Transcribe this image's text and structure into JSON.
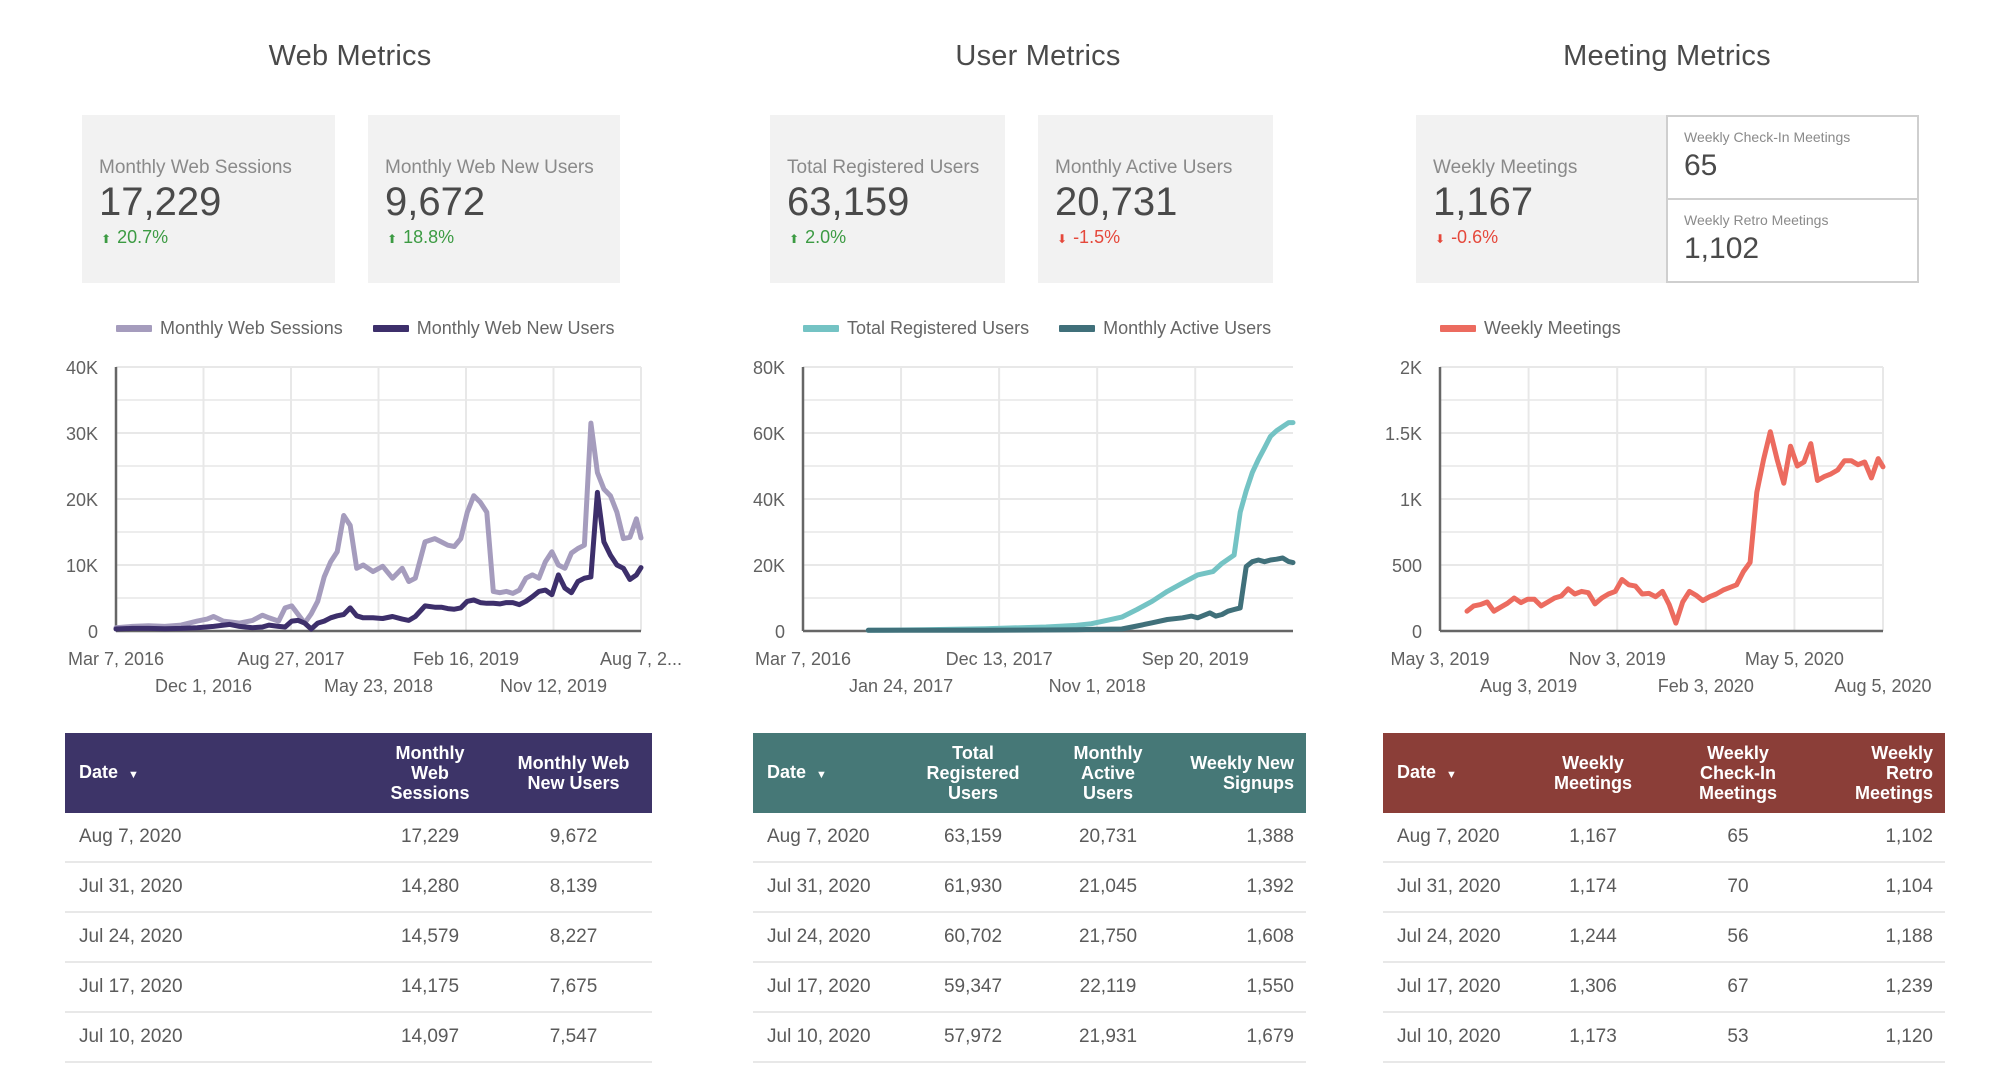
{
  "panels": {
    "web": {
      "title": "Web Metrics",
      "cards": [
        {
          "label": "Monthly Web Sessions",
          "value": "17,229",
          "delta": "20.7%",
          "direction": "up"
        },
        {
          "label": "Monthly Web New Users",
          "value": "9,672",
          "delta": "18.8%",
          "direction": "up"
        }
      ],
      "table": {
        "header_color": "#3d3468",
        "columns": [
          "Date",
          "Monthly Web Sessions",
          "Monthly Web New Users"
        ],
        "sort_icon": "sort-desc-icon",
        "rows": [
          [
            "Aug 7, 2020",
            "17,229",
            "9,672"
          ],
          [
            "Jul 31, 2020",
            "14,280",
            "8,139"
          ],
          [
            "Jul 24, 2020",
            "14,579",
            "8,227"
          ],
          [
            "Jul 17, 2020",
            "14,175",
            "7,675"
          ],
          [
            "Jul 10, 2020",
            "14,097",
            "7,547"
          ]
        ]
      }
    },
    "user": {
      "title": "User Metrics",
      "cards": [
        {
          "label": "Total Registered Users",
          "value": "63,159",
          "delta": "2.0%",
          "direction": "up"
        },
        {
          "label": "Monthly Active Users",
          "value": "20,731",
          "delta": "-1.5%",
          "direction": "down"
        }
      ],
      "table": {
        "header_color": "#467877",
        "columns": [
          "Date",
          "Total Registered Users",
          "Monthly Active Users",
          "Weekly New Signups"
        ],
        "sort_icon": "sort-desc-icon",
        "rows": [
          [
            "Aug 7, 2020",
            "63,159",
            "20,731",
            "1,388"
          ],
          [
            "Jul 31, 2020",
            "61,930",
            "21,045",
            "1,392"
          ],
          [
            "Jul 24, 2020",
            "60,702",
            "21,750",
            "1,608"
          ],
          [
            "Jul 17, 2020",
            "59,347",
            "22,119",
            "1,550"
          ],
          [
            "Jul 10, 2020",
            "57,972",
            "21,931",
            "1,679"
          ]
        ]
      }
    },
    "meeting": {
      "title": "Meeting Metrics",
      "cards": [
        {
          "label": "Weekly Meetings",
          "value": "1,167",
          "delta": "-0.6%",
          "direction": "down"
        }
      ],
      "mini_cards": [
        {
          "label": "Weekly Check-In Meetings",
          "value": "65"
        },
        {
          "label": "Weekly Retro Meetings",
          "value": "1,102"
        }
      ],
      "table": {
        "header_color": "#8b3e38",
        "columns": [
          "Date",
          "Weekly Meetings",
          "Weekly Check-In Meetings",
          "Weekly Retro Meetings"
        ],
        "sort_icon": "sort-desc-icon",
        "rows": [
          [
            "Aug 7, 2020",
            "1,167",
            "65",
            "1,102"
          ],
          [
            "Jul 31, 2020",
            "1,174",
            "70",
            "1,104"
          ],
          [
            "Jul 24, 2020",
            "1,244",
            "56",
            "1,188"
          ],
          [
            "Jul 17, 2020",
            "1,306",
            "67",
            "1,239"
          ],
          [
            "Jul 10, 2020",
            "1,173",
            "53",
            "1,120"
          ]
        ]
      }
    }
  },
  "icons": {
    "up": "arrow-up-icon",
    "down": "arrow-down-icon"
  },
  "colors": {
    "up": "#3c9b43",
    "down": "#e5483b"
  },
  "chart_data": [
    {
      "id": "web",
      "type": "line",
      "title": "",
      "xlabel": "",
      "ylabel": "",
      "ylim": [
        0,
        40000
      ],
      "yticks": [
        0,
        10000,
        20000,
        30000,
        40000
      ],
      "ytick_labels": [
        "0",
        "10K",
        "20K",
        "30K",
        "40K"
      ],
      "xlim": [
        0,
        1614
      ],
      "xticks": [
        0,
        269,
        538,
        807,
        1076,
        1345,
        1614
      ],
      "xtick_labels": [
        "Mar 7, 2016",
        "Dec 1, 2016",
        "Aug 27, 2017",
        "May 23, 2018",
        "Feb 16, 2019",
        "Nov 12, 2019",
        "Aug 7, 2..."
      ],
      "grid": true,
      "legend": "top",
      "series": [
        {
          "name": "Monthly Web Sessions",
          "color": "#a59cbd",
          "x": [
            0,
            50,
            100,
            150,
            200,
            250,
            280,
            300,
            330,
            380,
            420,
            450,
            470,
            500,
            520,
            540,
            560,
            580,
            600,
            620,
            640,
            660,
            680,
            700,
            720,
            740,
            760,
            790,
            820,
            850,
            880,
            900,
            920,
            950,
            980,
            1000,
            1020,
            1040,
            1060,
            1080,
            1100,
            1120,
            1140,
            1160,
            1180,
            1200,
            1220,
            1240,
            1260,
            1280,
            1300,
            1320,
            1340,
            1360,
            1380,
            1400,
            1420,
            1440,
            1460,
            1480,
            1500,
            1520,
            1540,
            1560,
            1580,
            1600,
            1614
          ],
          "y": [
            500,
            700,
            800,
            700,
            900,
            1500,
            1800,
            2200,
            1500,
            1200,
            1600,
            2400,
            2000,
            1500,
            3500,
            3800,
            2500,
            1200,
            2600,
            4500,
            8200,
            10500,
            12000,
            17500,
            16000,
            9500,
            10000,
            9000,
            9800,
            8000,
            9500,
            7500,
            8000,
            13500,
            14000,
            13500,
            13000,
            12800,
            14000,
            18000,
            20500,
            19500,
            18000,
            6000,
            5800,
            6000,
            5700,
            6200,
            8000,
            8500,
            8000,
            10500,
            12000,
            10000,
            9500,
            11800,
            12500,
            13000,
            31500,
            24000,
            21500,
            20500,
            18000,
            14000,
            14200,
            17000,
            14100
          ]
        },
        {
          "name": "Monthly Web New Users",
          "color": "#3d2f6b",
          "x": [
            0,
            50,
            100,
            150,
            200,
            250,
            300,
            350,
            380,
            420,
            450,
            470,
            500,
            520,
            540,
            560,
            580,
            600,
            620,
            640,
            660,
            680,
            700,
            720,
            740,
            760,
            790,
            820,
            850,
            880,
            900,
            920,
            950,
            980,
            1000,
            1020,
            1040,
            1060,
            1080,
            1100,
            1120,
            1140,
            1160,
            1180,
            1200,
            1220,
            1240,
            1260,
            1280,
            1300,
            1320,
            1340,
            1360,
            1380,
            1400,
            1420,
            1440,
            1460,
            1480,
            1500,
            1520,
            1540,
            1560,
            1580,
            1600,
            1614
          ],
          "y": [
            300,
            400,
            400,
            350,
            400,
            500,
            700,
            1000,
            700,
            500,
            600,
            900,
            700,
            600,
            1500,
            1600,
            1200,
            300,
            1200,
            1500,
            2000,
            2300,
            2500,
            3500,
            2300,
            2000,
            2000,
            1900,
            2200,
            1800,
            1600,
            2200,
            3800,
            3600,
            3600,
            3400,
            3300,
            3500,
            4500,
            4700,
            4300,
            4200,
            4200,
            4100,
            4300,
            4300,
            4000,
            4500,
            5200,
            6000,
            6200,
            5500,
            8500,
            6500,
            5800,
            7500,
            8000,
            8200,
            21000,
            13500,
            11500,
            10000,
            9500,
            7800,
            8500,
            9600
          ]
        }
      ]
    },
    {
      "id": "user",
      "type": "line",
      "title": "",
      "xlabel": "",
      "ylabel": "",
      "ylim": [
        0,
        80000
      ],
      "yticks": [
        0,
        20000,
        40000,
        60000,
        80000
      ],
      "ytick_labels": [
        "0",
        "20K",
        "40K",
        "60K",
        "80K"
      ],
      "xlim": [
        0,
        1614
      ],
      "xticks": [
        0,
        323,
        646,
        969,
        1292
      ],
      "xtick_labels": [
        "Mar 7, 2016",
        "Jan 24, 2017",
        "Dec 13, 2017",
        "Nov 1, 2018",
        "Sep 20, 2019"
      ],
      "grid": true,
      "legend": "top",
      "series": [
        {
          "name": "Total Registered Users",
          "color": "#74c3c4",
          "x": [
            215,
            400,
            600,
            800,
            900,
            950,
            1000,
            1050,
            1100,
            1150,
            1200,
            1250,
            1300,
            1350,
            1380,
            1420,
            1440,
            1460,
            1480,
            1500,
            1520,
            1540,
            1560,
            1580,
            1600,
            1614
          ],
          "y": [
            200,
            400,
            700,
            1200,
            1700,
            2200,
            3200,
            4200,
            6500,
            9000,
            12000,
            14500,
            17000,
            18000,
            20500,
            23000,
            36000,
            42500,
            48000,
            52000,
            55500,
            59000,
            60700,
            61930,
            63159,
            63159
          ]
        },
        {
          "name": "Monthly Active Users",
          "color": "#40707a",
          "x": [
            215,
            400,
            600,
            800,
            900,
            950,
            1050,
            1100,
            1150,
            1200,
            1250,
            1280,
            1300,
            1340,
            1360,
            1380,
            1400,
            1420,
            1440,
            1460,
            1480,
            1500,
            1520,
            1540,
            1560,
            1580,
            1600,
            1614
          ],
          "y": [
            200,
            200,
            200,
            300,
            400,
            500,
            600,
            1500,
            2500,
            3500,
            4000,
            4500,
            4000,
            5500,
            4500,
            5000,
            6000,
            6500,
            7000,
            19500,
            21000,
            21500,
            21000,
            21500,
            21750,
            22119,
            21045,
            20731
          ]
        }
      ]
    },
    {
      "id": "meeting",
      "type": "line",
      "title": "",
      "xlabel": "",
      "ylabel": "",
      "ylim": [
        0,
        2000
      ],
      "yticks": [
        0,
        500,
        1000,
        1500,
        2000
      ],
      "ytick_labels": [
        "0",
        "500",
        "1K",
        "1.5K",
        "2K"
      ],
      "xlim": [
        0,
        460
      ],
      "xticks": [
        0,
        92,
        184,
        276,
        368,
        460
      ],
      "xtick_labels": [
        "May 3, 2019",
        "Aug 3, 2019",
        "Nov 3, 2019",
        "Feb 3, 2020",
        "May 5, 2020",
        "Aug 5, 2020"
      ],
      "grid": true,
      "legend": "top",
      "series": [
        {
          "name": "Weekly Meetings",
          "color": "#ec6b5f",
          "x": [
            28,
            35,
            42,
            49,
            56,
            63,
            70,
            77,
            84,
            91,
            98,
            105,
            112,
            119,
            126,
            133,
            140,
            147,
            154,
            161,
            168,
            175,
            182,
            189,
            196,
            203,
            210,
            217,
            224,
            231,
            238,
            245,
            252,
            259,
            266,
            273,
            280,
            287,
            294,
            301,
            308,
            315,
            322,
            329,
            336,
            343,
            350,
            357,
            364,
            371,
            378,
            385,
            392,
            399,
            406,
            413,
            420,
            427,
            434,
            441,
            448,
            455,
            460
          ],
          "y": [
            150,
            190,
            200,
            220,
            150,
            180,
            210,
            250,
            215,
            240,
            240,
            190,
            220,
            250,
            265,
            320,
            280,
            300,
            290,
            205,
            250,
            280,
            300,
            390,
            350,
            340,
            280,
            285,
            260,
            300,
            200,
            60,
            220,
            300,
            270,
            230,
            260,
            280,
            310,
            330,
            350,
            450,
            520,
            1050,
            1300,
            1510,
            1300,
            1120,
            1400,
            1250,
            1280,
            1420,
            1140,
            1170,
            1190,
            1220,
            1290,
            1290,
            1260,
            1280,
            1160,
            1306,
            1244,
            1174,
            1167
          ]
        }
      ]
    }
  ]
}
